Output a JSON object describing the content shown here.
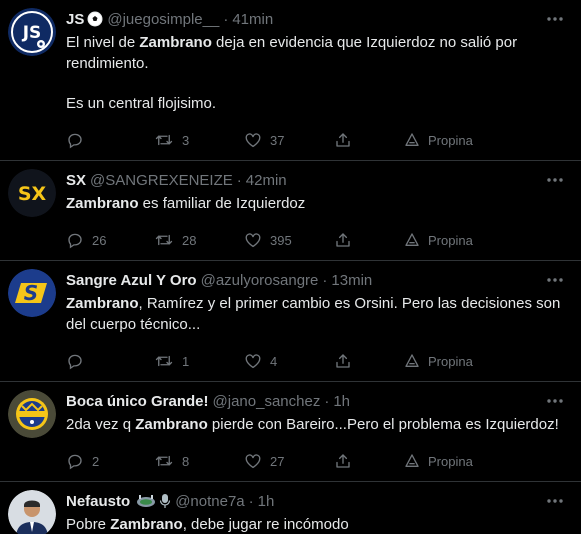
{
  "tweets": [
    {
      "name": "JS",
      "handle": "@juegosimple__",
      "time": "41min",
      "text": [
        [
          {
            "t": "El nivel de "
          },
          {
            "t": "Zambrano",
            "b": true
          },
          {
            "t": " deja en evidencia que Izquierdoz no salió por rendimiento."
          }
        ],
        [
          {
            "t": "Es un central flojisimo."
          }
        ]
      ],
      "replies": "",
      "retweets": "3",
      "likes": "37",
      "promote": "Propina",
      "avatar": {
        "type": "js",
        "label": "JS",
        "bg": "#0f2a63"
      }
    },
    {
      "name": "SX",
      "handle": "@SANGREXENEIZE",
      "time": "42min",
      "text": [
        [
          {
            "t": "Zambrano",
            "b": true
          },
          {
            "t": " es familiar de Izquierdoz"
          }
        ]
      ],
      "replies": "26",
      "retweets": "28",
      "likes": "395",
      "promote": "Propina",
      "avatar": {
        "type": "sx",
        "label": "SX",
        "bg": "#10141c"
      }
    },
    {
      "name": "Sangre Azul Y Oro",
      "handle": "@azulyorosangre",
      "time": "13min",
      "text": [
        [
          {
            "t": "Zambrano",
            "b": true
          },
          {
            "t": ", Ramírez y el primer cambio es Orsini. Pero las decisiones son del cuerpo técnico..."
          }
        ]
      ],
      "replies": "",
      "retweets": "1",
      "likes": "4",
      "promote": "Propina",
      "avatar": {
        "type": "s",
        "label": "S",
        "bg": "#1c3c8c"
      }
    },
    {
      "name": "Boca único Grande!",
      "handle": "@jano_sanchez",
      "time": "1h",
      "text": [
        [
          {
            "t": "2da vez q "
          },
          {
            "t": "Zambrano",
            "b": true
          },
          {
            "t": " pierde con Bareiro...Pero el problema es Izquierdoz!"
          }
        ]
      ],
      "replies": "2",
      "retweets": "8",
      "likes": "27",
      "promote": "Propina",
      "avatar": {
        "type": "crest",
        "label": "",
        "bg": "#4a4a38"
      }
    },
    {
      "name": "Nefausto",
      "handle": "@notne7a",
      "time": "1h",
      "text": [
        [
          {
            "t": "Pobre "
          },
          {
            "t": "Zambrano",
            "b": true
          },
          {
            "t": ", debe jugar re incómodo"
          }
        ]
      ],
      "replies": "",
      "retweets": "",
      "likes": "",
      "promote": "Propina",
      "avatar": {
        "type": "person",
        "label": "",
        "bg": "#d8dde3"
      }
    }
  ],
  "icons": {
    "reply": "reply-icon",
    "retweet": "retweet-icon",
    "like": "like-icon",
    "share": "share-icon",
    "promote": "promote-icon",
    "more": "more-icon",
    "soccer": "soccer-ball-emoji",
    "stadium": "stadium-emoji",
    "microphone": "microphone-emoji"
  },
  "colors": {
    "background": "#000000",
    "text": "#e7e9ea",
    "secondary": "#71767b",
    "border": "#2f3336",
    "sx_gold": "#f5c518"
  }
}
